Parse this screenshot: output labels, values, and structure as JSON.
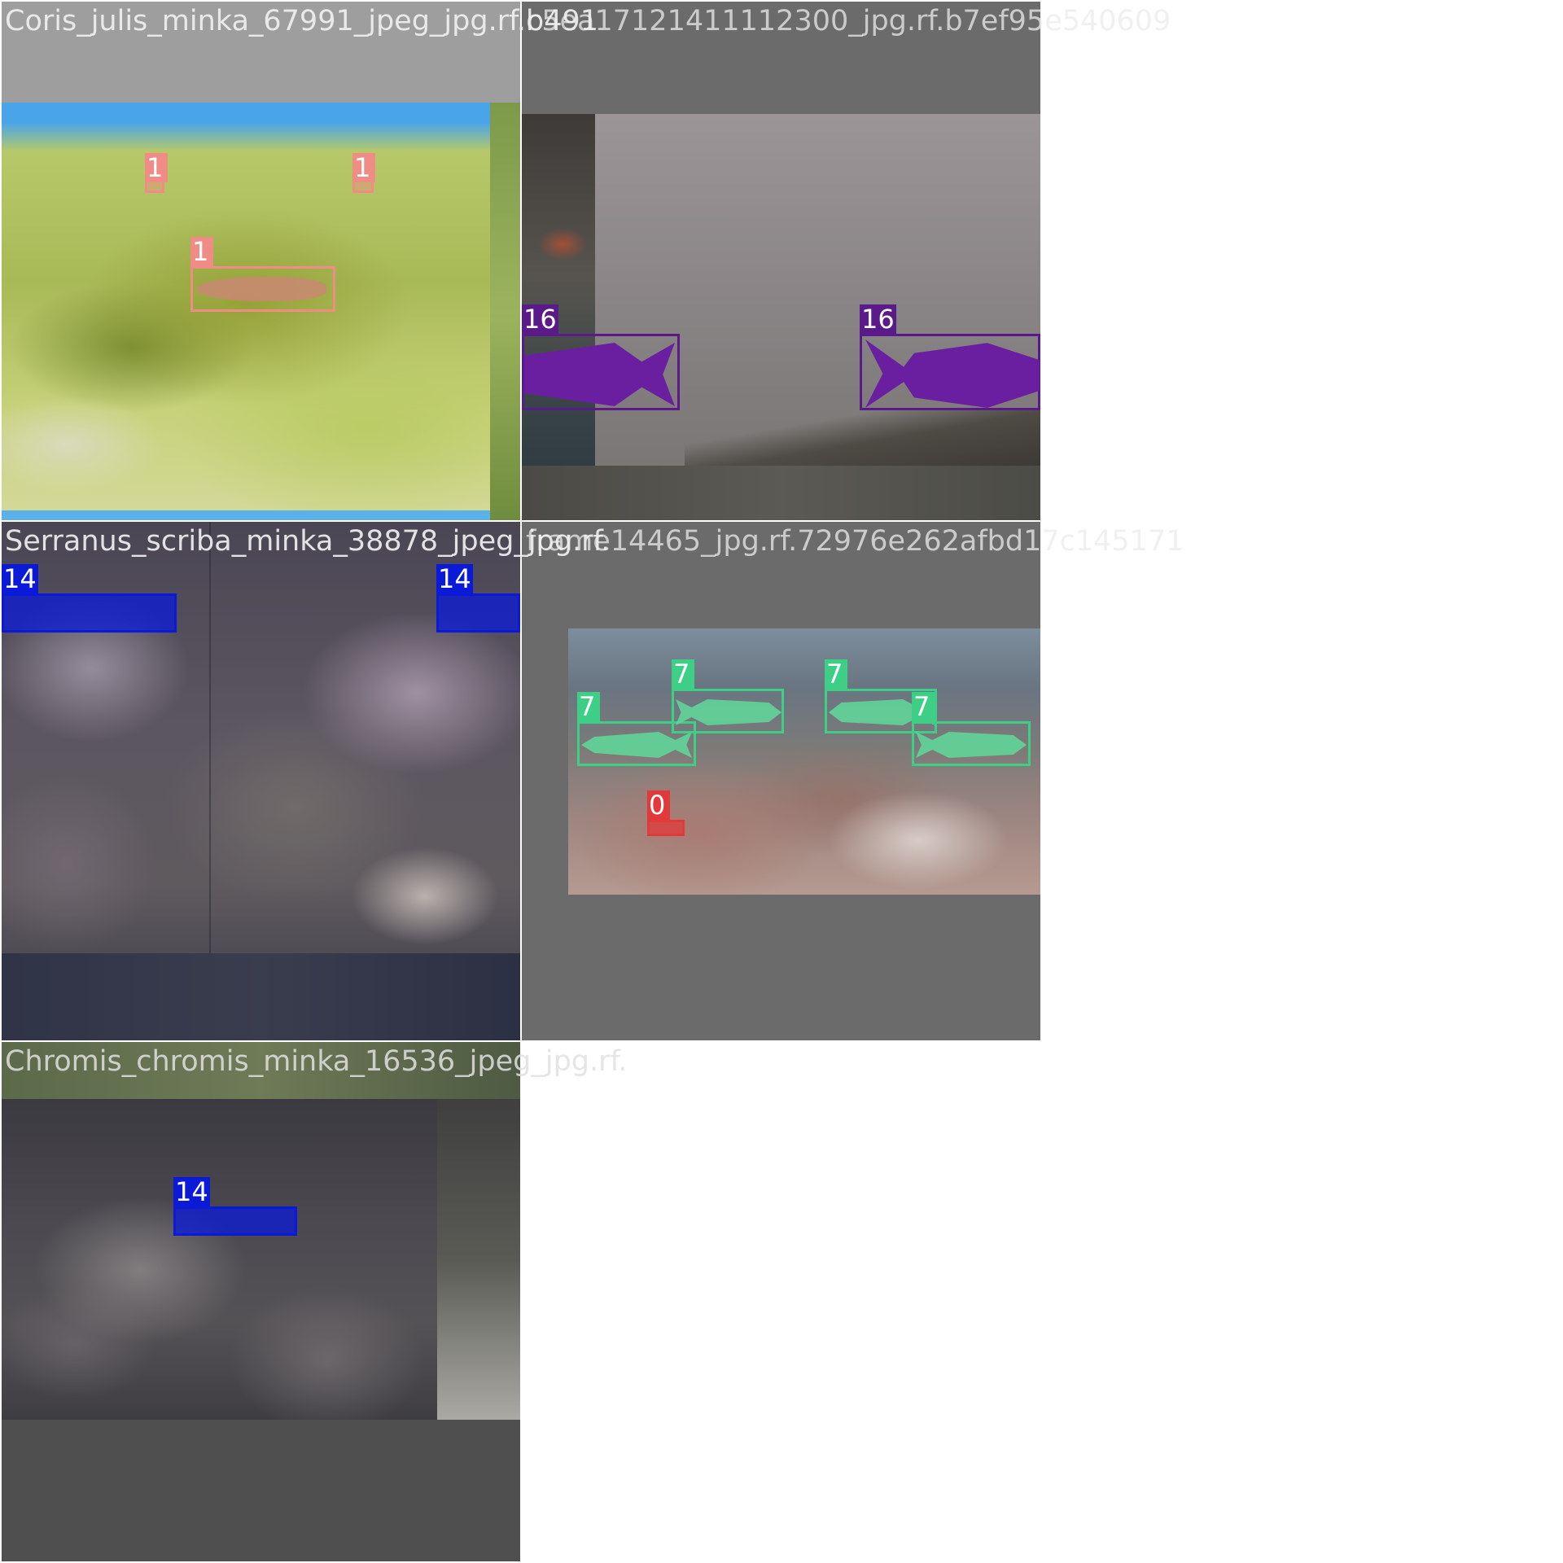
{
  "mosaic": {
    "tiles": [
      {
        "caption": "Coris_julis_minka_67991_jpeg_jpg.rf.b491",
        "caption_overlap": "c5ea17121411112300_jpg.rf.b7ef95e540609",
        "labels": [
          {
            "text": "1",
            "color": "#f08c86"
          },
          {
            "text": "1",
            "color": "#f08c86"
          },
          {
            "text": "1",
            "color": "#f08c86"
          }
        ]
      },
      {
        "caption": "c5ea17121411112300_jpg.rf.b7ef95e540609",
        "labels": [
          {
            "text": "16",
            "color": "#5a1a8a"
          },
          {
            "text": "16",
            "color": "#5a1a8a"
          }
        ]
      },
      {
        "caption": "Serranus_scriba_minka_38878_jpeg_jpg.rf.",
        "caption_overlap": "frame14465_jpg.rf.72976e262afbd17c145171",
        "labels": [
          {
            "text": "14",
            "color": "#0a1ad8"
          },
          {
            "text": "14",
            "color": "#0a1ad8"
          }
        ]
      },
      {
        "caption": "frame14465_jpg.rf.72976e262afbd17c145171",
        "labels": [
          {
            "text": "7",
            "color": "#3ecf86"
          },
          {
            "text": "7",
            "color": "#3ecf86"
          },
          {
            "text": "7",
            "color": "#3ecf86"
          },
          {
            "text": "7",
            "color": "#3ecf86"
          },
          {
            "text": "0",
            "color": "#e23a3a"
          }
        ]
      },
      {
        "caption": "Chromis_chromis_minka_16536_jpeg_jpg.rf.",
        "labels": [
          {
            "text": "14",
            "color": "#0a1ad8"
          }
        ]
      }
    ]
  }
}
